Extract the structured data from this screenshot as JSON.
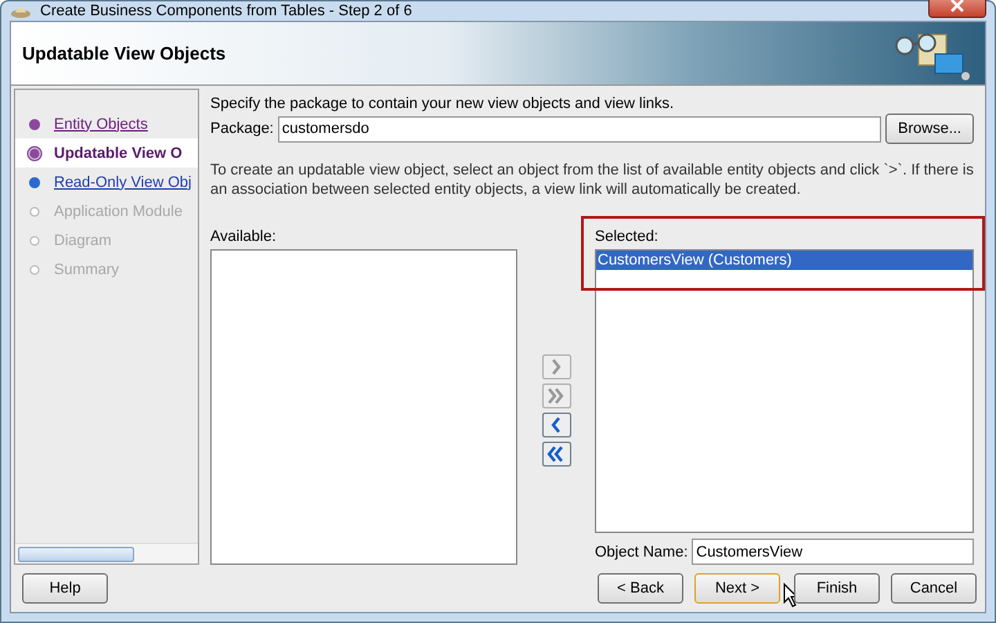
{
  "window": {
    "title": "Create Business Components from Tables - Step 2 of 6"
  },
  "header": {
    "title": "Updatable View Objects"
  },
  "steps": [
    {
      "label": "Entity Objects",
      "visited": true,
      "selected": false,
      "disabled": false
    },
    {
      "label": "Updatable View O",
      "visited": false,
      "selected": true,
      "disabled": false
    },
    {
      "label": "Read-Only View Obj",
      "visited": false,
      "selected": false,
      "disabled": false
    },
    {
      "label": "Application Module",
      "visited": false,
      "selected": false,
      "disabled": true
    },
    {
      "label": "Diagram",
      "visited": false,
      "selected": false,
      "disabled": true
    },
    {
      "label": "Summary",
      "visited": false,
      "selected": false,
      "disabled": true
    }
  ],
  "package_hint": "Specify the package to contain your new view objects and view links.",
  "package": {
    "label": "Package:",
    "value": "customersdo",
    "browse": "Browse..."
  },
  "instructions": "To create an updatable view object, select an object from the list of available entity objects and click `>`.  If there is an association between selected entity objects, a view link will automatically be created.",
  "available": {
    "label": "Available:"
  },
  "shuttle": [
    {
      "kind": "add",
      "disabled": true
    },
    {
      "kind": "add_all",
      "disabled": true
    },
    {
      "kind": "remove",
      "disabled": false
    },
    {
      "kind": "remove_all",
      "disabled": false
    }
  ],
  "selected": {
    "label": "Selected:",
    "items": [
      {
        "label": "CustomersView (Customers)",
        "selected": true
      }
    ]
  },
  "object_name": {
    "label": "Object Name:",
    "value": "CustomersView"
  },
  "buttons": {
    "help": "Help",
    "back": "< Back",
    "next": "Next >",
    "finish": "Finish",
    "cancel": "Cancel"
  }
}
